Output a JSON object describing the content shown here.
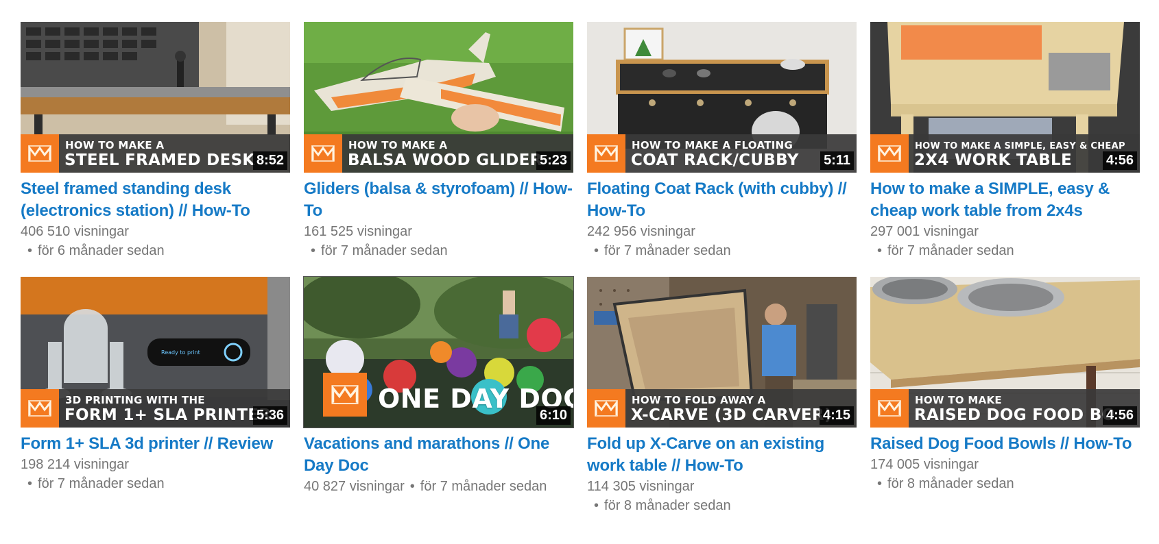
{
  "videos": [
    {
      "title": "Steel framed standing desk (electronics station) // How-To",
      "views": "406 510 visningar",
      "age": "för 6 månader sedan",
      "duration": "8:52",
      "caption_small": "HOW TO MAKE A",
      "caption_big": "STEEL FRAMED DESK"
    },
    {
      "title": "Gliders (balsa & styrofoam) // How-To",
      "views": "161 525 visningar",
      "age": "för 7 månader sedan",
      "duration": "5:23",
      "caption_small": "HOW TO MAKE A",
      "caption_big": "BALSA WOOD GLIDER"
    },
    {
      "title": "Floating Coat Rack (with cubby) // How-To",
      "views": "242 956 visningar",
      "age": "för 7 månader sedan",
      "duration": "5:11",
      "caption_small": "HOW TO MAKE A FLOATING",
      "caption_big": "COAT RACK/CUBBY"
    },
    {
      "title": "How to make a SIMPLE, easy & cheap work table from 2x4s",
      "views": "297 001 visningar",
      "age": "för 7 månader sedan",
      "duration": "4:56",
      "caption_small": "HOW TO MAKE A SIMPLE, EASY & CHEAP",
      "caption_big": "2X4 WORK TABLE"
    },
    {
      "title": "Form 1+ SLA 3d printer // Review",
      "views": "198 214 visningar",
      "age": "för 7 månader sedan",
      "duration": "5:36",
      "caption_small": "3D PRINTING WITH THE",
      "caption_big": "FORM 1+ SLA PRINTER"
    },
    {
      "title": "Vacations and marathons // One Day Doc",
      "views": "40 827 visningar",
      "age": "för 7 månader sedan",
      "duration": "6:10",
      "caption_big": "ONE DAY DOC"
    },
    {
      "title": "Fold up X-Carve on an existing work table // How-To",
      "views": "114 305 visningar",
      "age": "för 8 månader sedan",
      "duration": "4:15",
      "caption_small": "HOW TO FOLD AWAY A",
      "caption_big": "X-CARVE (3D CARVER)"
    },
    {
      "title": "Raised Dog Food Bowls // How-To",
      "views": "174 005 visningar",
      "age": "för 8 månader sedan",
      "duration": "4:56",
      "caption_small": "HOW TO MAKE",
      "caption_big": "RAISED DOG FOOD BO"
    }
  ],
  "meta": {
    "separator": "•"
  },
  "colors": {
    "title_link": "#167ac6",
    "meta_text": "#767676",
    "brand_orange": "#f47a20"
  },
  "icons": {
    "channel_logo": "maker-logo-icon"
  }
}
